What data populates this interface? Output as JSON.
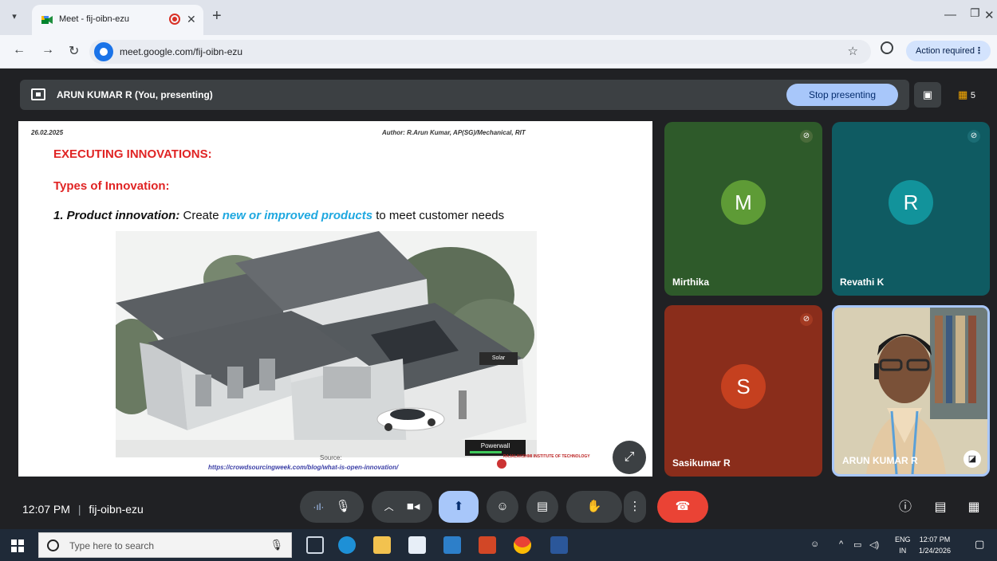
{
  "browser": {
    "tab_title": "Meet - fij-oibn-ezu",
    "url": "meet.google.com/fij-oibn-ezu",
    "action_required": "Action required"
  },
  "meet": {
    "presenter_label": "ARUN KUMAR R (You, presenting)",
    "stop_presenting": "Stop presenting",
    "people_count": "5",
    "time": "12:07 PM",
    "meeting_code": "fij-oibn-ezu",
    "slide": {
      "date": "26.02.2025",
      "author": "Author: R.Arun Kumar, AP(SG)/Mechanical, RIT",
      "heading": "EXECUTING INNOVATIONS:",
      "subheading": "Types of Innovation:",
      "item_prefix": "1. Product innovation:",
      "item_text_1": " Create ",
      "item_highlight": "new or improved products",
      "item_text_2": " to meet customer needs",
      "label_solar": "Solar",
      "label_powerwall": "Powerwall",
      "source_label": "Source:",
      "source_url": "https://crowdsourcingweek.com/blog/what-is-open-innovation/",
      "institute": "RAJALAKSHMI INSTITUTE OF TECHNOLOGY"
    },
    "participants": [
      {
        "name": "Mirthika",
        "initial": "M",
        "bg": "#2e5a2a",
        "avatar_color": "#5e9b36"
      },
      {
        "name": "Revathi K",
        "initial": "R",
        "bg": "#0f5b62",
        "avatar_color": "#12939b"
      },
      {
        "name": "Sasikumar R",
        "initial": "S",
        "bg": "#8a2d1b",
        "avatar_color": "#c5401f"
      },
      {
        "name": "ARUN KUMAR R",
        "initial": "",
        "bg": "#cbbf9e",
        "avatar_color": ""
      }
    ]
  },
  "taskbar": {
    "search_placeholder": "Type here to search",
    "lang": "ENG",
    "region": "IN",
    "time": "12:07 PM",
    "date": "1/24/2026"
  }
}
